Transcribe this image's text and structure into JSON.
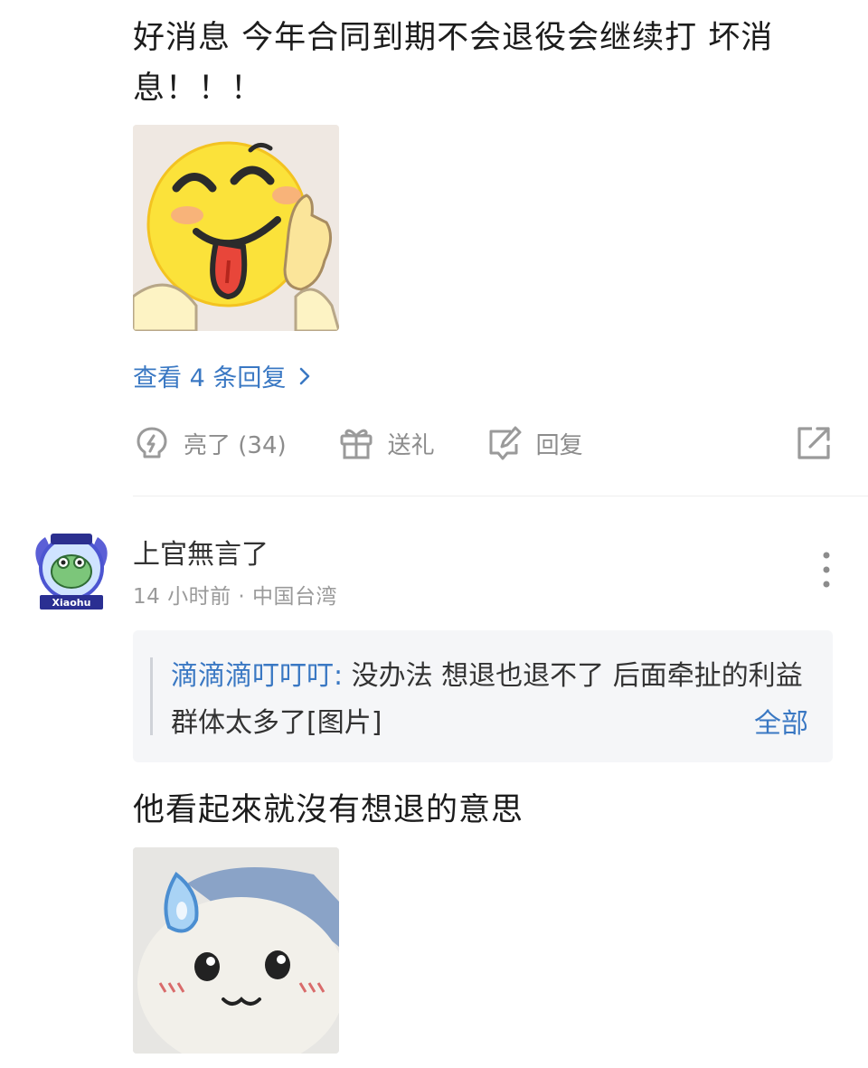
{
  "comment1": {
    "text": "好消息 今年合同到期不会退役会继续打 坏消息！！！",
    "sticker_icon": "laughing-tongue-emoji-sticker",
    "view_replies_label": "查看 4 条回复",
    "actions": {
      "like_label": "亮了 (34)",
      "gift_label": "送礼",
      "reply_label": "回复"
    }
  },
  "comment2": {
    "username": "上官無言了",
    "avatar_badge_text": "Xiaohu",
    "meta": "14 小时前 · 中国台湾",
    "quote": {
      "user": "滴滴滴叮叮叮:",
      "text": " 没办法 想退也退不了 后面牵扯的利益群体太多了[图片]",
      "all_label": "全部"
    },
    "text": "他看起來就沒有想退的意思",
    "sticker_icon": "sweating-cat-sticker"
  },
  "colors": {
    "link": "#3a78c3",
    "muted": "#8c8c8c",
    "quote_bg": "#f5f6f8"
  }
}
